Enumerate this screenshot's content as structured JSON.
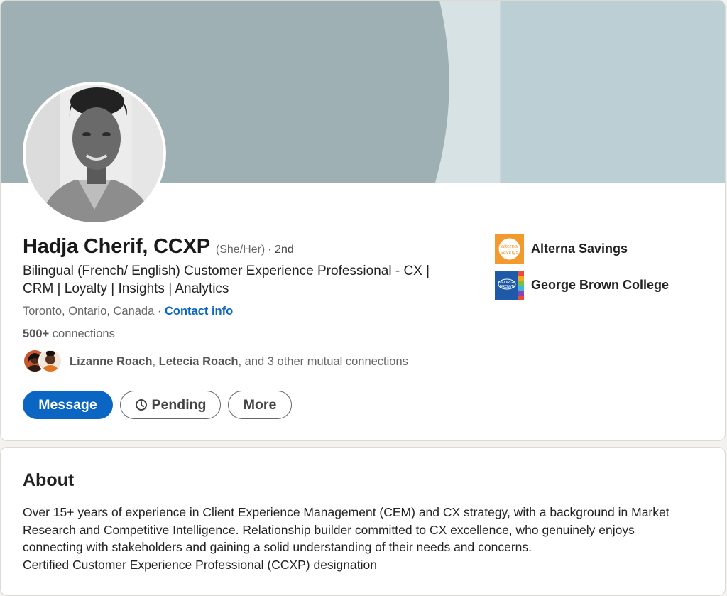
{
  "profile": {
    "name": "Hadja Cherif, CCXP",
    "pronouns": "(She/Her)",
    "degree": "· 2nd",
    "headline_line1": "Bilingual (French/ English) Customer Experience Professional - CX |",
    "headline_line2": "CRM | Loyalty | Insights | Analytics",
    "location": "Toronto, Ontario, Canada",
    "location_separator": "·",
    "contact_info": "Contact info",
    "connections_count": "500+",
    "connections_label": "connections",
    "mutual": {
      "name1": "Lizanne Roach",
      "separator": ",",
      "name2": "Letecia Roach",
      "suffix": ", and 3 other mutual connections"
    }
  },
  "actions": {
    "message": "Message",
    "pending": "Pending",
    "more": "More"
  },
  "orgs": [
    {
      "name": "Alterna Savings",
      "logo_text_1": "alterna",
      "logo_text_2": "savings",
      "icon": "alterna-logo"
    },
    {
      "name": "George Brown College",
      "logo_text_1": "GEORGE",
      "logo_text_2": "BROWN",
      "icon": "george-brown-logo"
    }
  ],
  "about": {
    "title": "About",
    "lines": [
      "Over 15+ years of experience in Client Experience Management (CEM) and CX strategy, with a background in Market",
      "Research and Competitive Intelligence. Relationship builder committed to CX excellence, who genuinely enjoys",
      "connecting with stakeholders and gaining a solid understanding of their needs and concerns.",
      "Certified Customer Experience Professional (CCXP) designation"
    ]
  },
  "colors": {
    "accent": "#0a66c2",
    "banner_left": "#9fb0b4",
    "banner_mid": "#d6e2e4",
    "banner_right": "#bccfd4",
    "alterna_orange": "#f39a2e",
    "george_brown_blue": "#1f5aa8"
  }
}
